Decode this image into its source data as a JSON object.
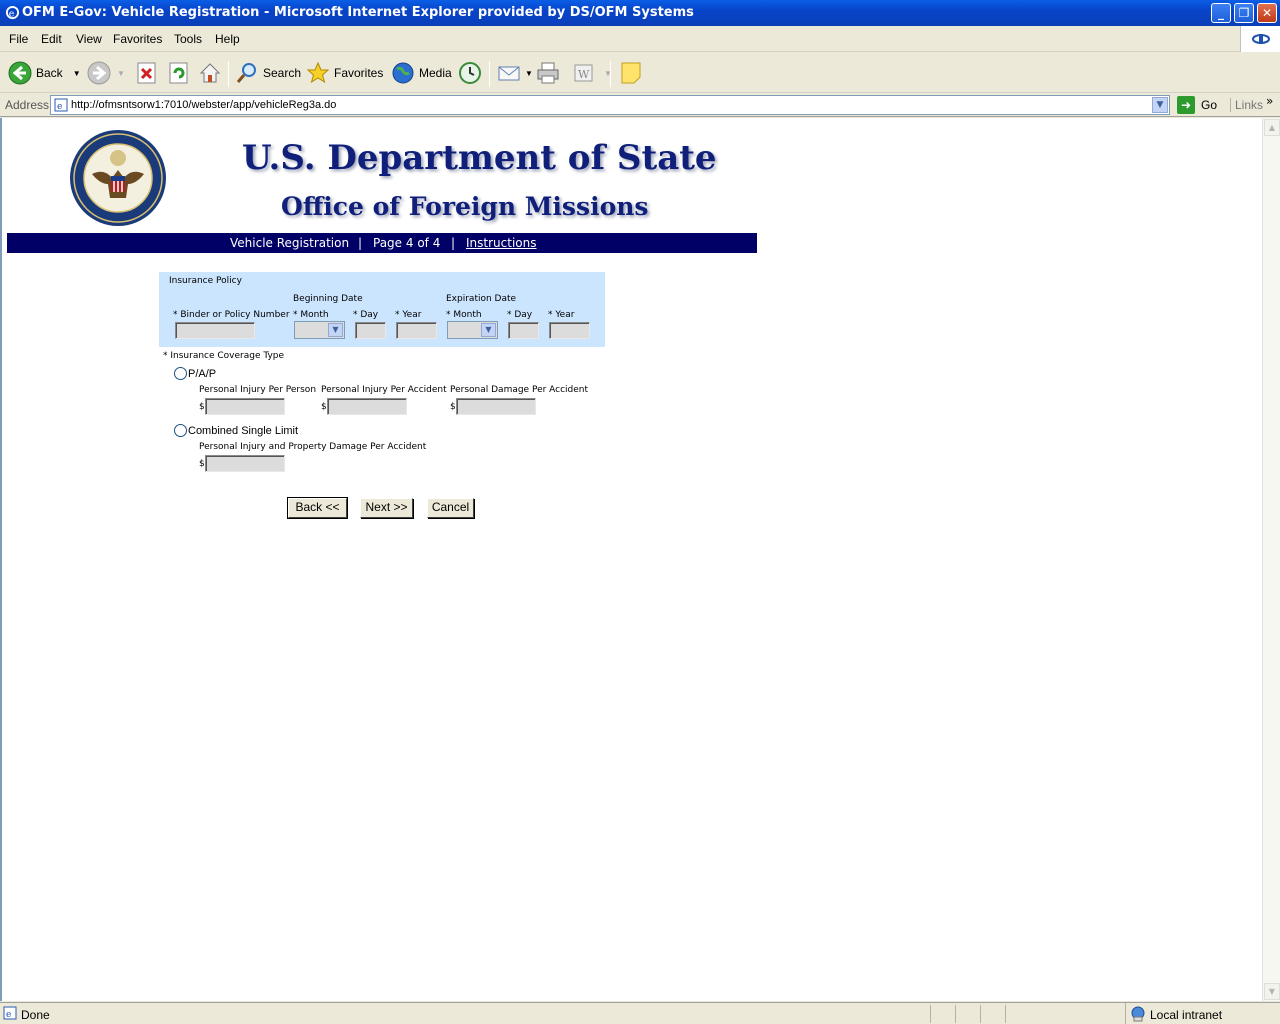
{
  "window": {
    "title": "OFM E-Gov: Vehicle Registration - Microsoft Internet Explorer provided by DS/OFM Systems",
    "minimize": "_",
    "restore": "❐",
    "close": "✕"
  },
  "menu": [
    "File",
    "Edit",
    "View",
    "Favorites",
    "Tools",
    "Help"
  ],
  "toolbar": {
    "back": "Back",
    "search": "Search",
    "favorites": "Favorites",
    "media": "Media"
  },
  "address": {
    "label": "Address",
    "url": "http://ofmsntsorw1:7010/webster/app/vehicleReg3a.do",
    "go": "Go",
    "links": "Links",
    "more": "»"
  },
  "header": {
    "dept": "U.S. Department of State",
    "office": "Office of Foreign Missions"
  },
  "nav": {
    "section": "Vehicle Registration",
    "sep": "|",
    "page": "Page 4 of 4",
    "instructions": "Instructions"
  },
  "form": {
    "panel_title": "Insurance Policy",
    "policy_number_label": "* Binder or Policy Number",
    "beginning_date_label": "Beginning Date",
    "expiration_date_label": "Expiration Date",
    "month_label": "* Month",
    "day_label": "* Day",
    "year_label": "* Year",
    "coverage_type_label": "* Insurance Coverage Type",
    "pap_label": "P/A/P",
    "injury_per_person_label": "Personal Injury Per Person",
    "injury_per_accident_label": "Personal Injury Per Accident",
    "damage_per_accident_label": "Personal Damage Per Accident",
    "csl_label": "Combined Single Limit",
    "csl_amount_label": "Personal Injury and Property Damage Per Accident",
    "currency": "$"
  },
  "buttons": {
    "back": "Back <<",
    "next": "Next >>",
    "cancel": "Cancel"
  },
  "status": {
    "text": "Done",
    "zone": "Local intranet"
  },
  "colors": {
    "title_blue": "#0a5ee6",
    "nav_bar": "#000066",
    "heading": "#0f1f7a",
    "panel_bg": "#cce5ff"
  }
}
